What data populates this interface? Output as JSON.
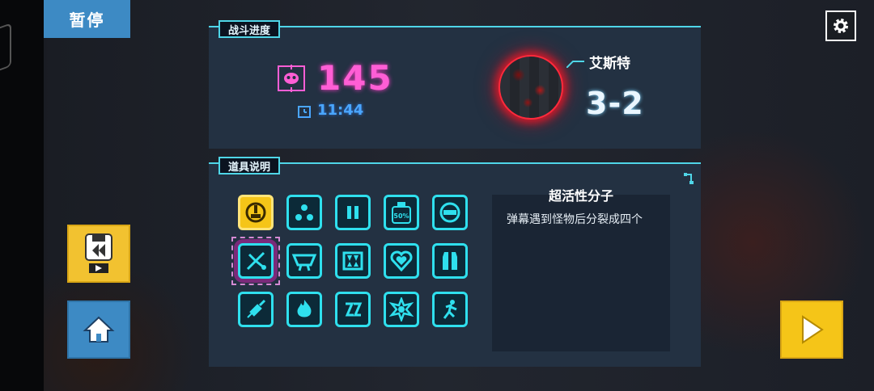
{
  "pause_tab": {
    "label": "暂停"
  },
  "settings": {
    "icon": "gear-icon"
  },
  "side_buttons": {
    "replay": {
      "icon": "save-replay-icon"
    },
    "home": {
      "icon": "home-icon"
    },
    "resume": {
      "icon": "play-icon"
    }
  },
  "progress": {
    "title": "战斗进度",
    "kills": "145",
    "time": "11:44",
    "level_name": "艾斯特",
    "level": "3-2"
  },
  "items_panel": {
    "title": "道具说明",
    "items": [
      {
        "icon": "power-plug-icon",
        "active": true
      },
      {
        "icon": "three-dots-icon"
      },
      {
        "icon": "pause-bars-icon"
      },
      {
        "icon": "fifty-percent-bottle-icon",
        "text": "50%"
      },
      {
        "icon": "no-entry-icon"
      },
      {
        "icon": "split-molecule-icon",
        "selected": true
      },
      {
        "icon": "bowl-icon"
      },
      {
        "icon": "fangs-icon"
      },
      {
        "icon": "heart-icon"
      },
      {
        "icon": "vest-icon"
      },
      {
        "icon": "syringe-icon"
      },
      {
        "icon": "fire-icon"
      },
      {
        "icon": "zigzag-icon"
      },
      {
        "icon": "explosion-icon"
      },
      {
        "icon": "runner-icon"
      }
    ],
    "selected_name": "超活性分子",
    "selected_desc": "弹幕遇到怪物后分裂成四个"
  }
}
